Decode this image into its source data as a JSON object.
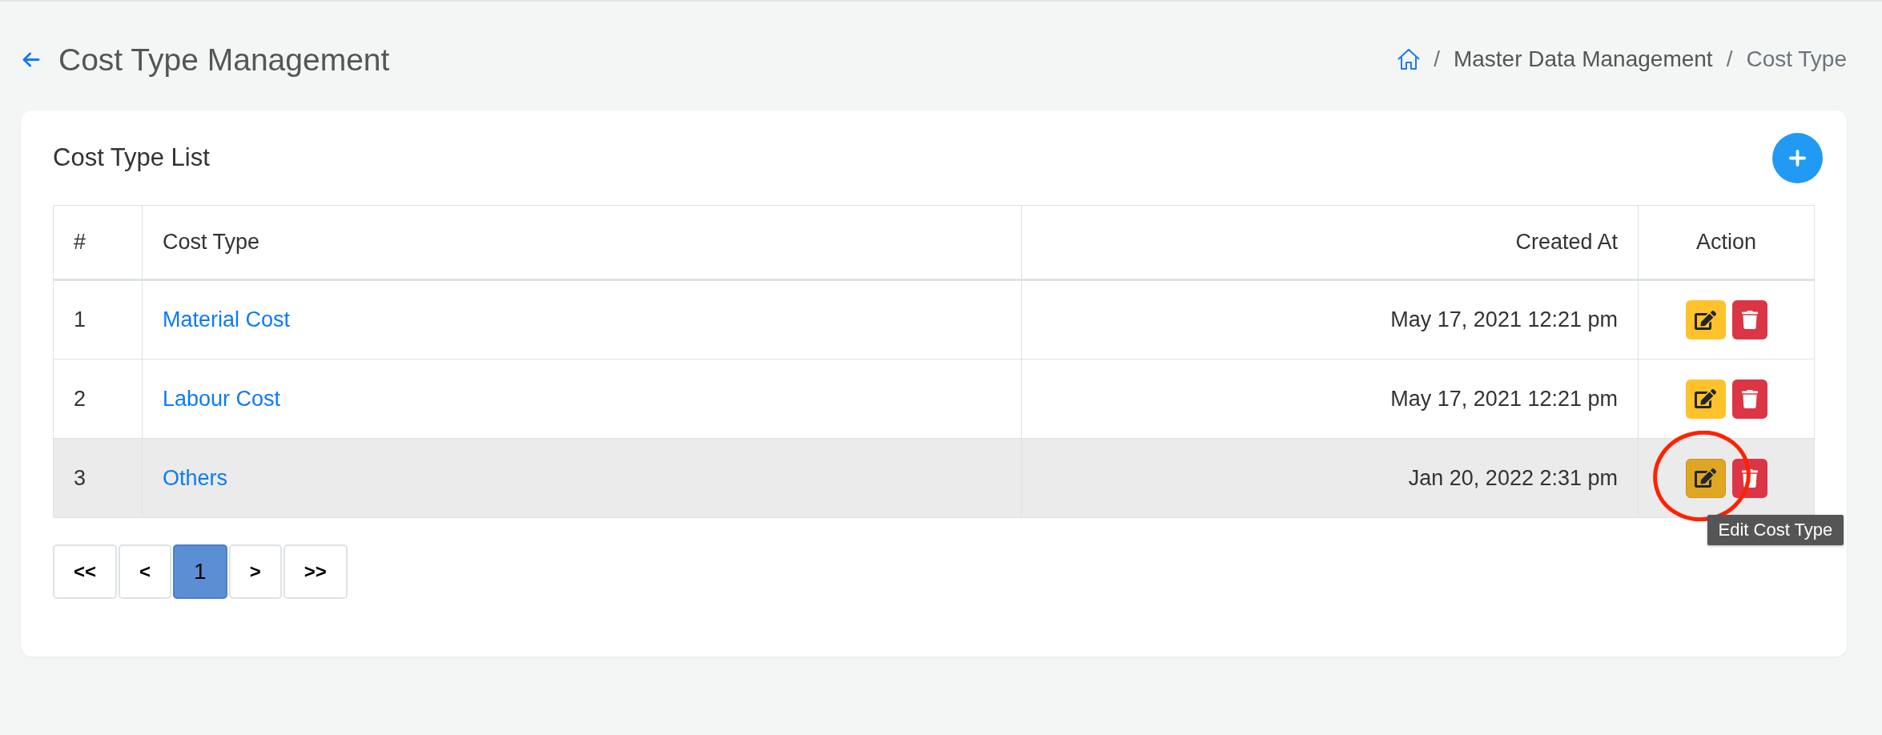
{
  "header": {
    "title": "Cost Type Management",
    "breadcrumb": [
      {
        "separator": "/",
        "label": "Master Data Management",
        "current": false
      },
      {
        "separator": "/",
        "label": "Cost Type",
        "current": true
      }
    ]
  },
  "card": {
    "title": "Cost Type List"
  },
  "table": {
    "columns": [
      "#",
      "Cost Type",
      "Created At",
      "Action"
    ],
    "rows": [
      {
        "number": "1",
        "cost_type": "Material Cost",
        "created_at": "May 17, 2021 12:21 pm",
        "hovered": false,
        "circled": false
      },
      {
        "number": "2",
        "cost_type": "Labour Cost",
        "created_at": "May 17, 2021 12:21 pm",
        "hovered": false,
        "circled": false
      },
      {
        "number": "3",
        "cost_type": "Others",
        "created_at": "Jan 20, 2022 2:31 pm",
        "hovered": true,
        "circled": true,
        "tooltip": "Edit Cost Type"
      }
    ]
  },
  "pagination": [
    {
      "label": "<<",
      "selected": false
    },
    {
      "label": "<",
      "selected": false
    },
    {
      "label": "1",
      "selected": true
    },
    {
      "label": ">",
      "selected": false
    },
    {
      "label": ">>",
      "selected": false
    }
  ]
}
